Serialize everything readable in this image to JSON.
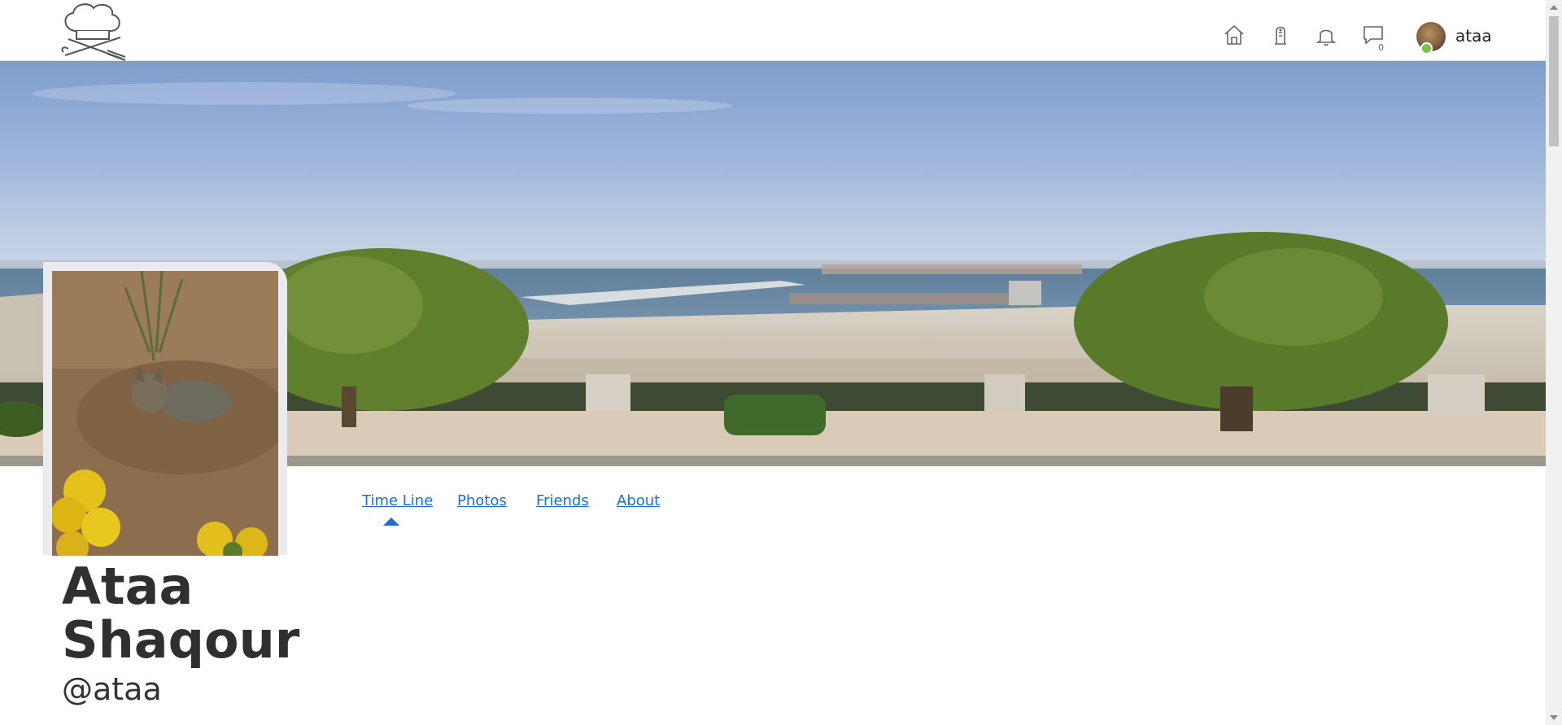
{
  "header": {
    "logo_icon": "chef-hat-logo-icon",
    "nav_icons": [
      "home-icon",
      "recipes-icon",
      "notifications-bell-icon",
      "messages-icon"
    ],
    "messages_badge": "0",
    "user_name": "ataa"
  },
  "profile": {
    "tabs": [
      {
        "label": "Time Line",
        "active": true
      },
      {
        "label": "Photos",
        "active": false
      },
      {
        "label": "Friends",
        "active": false
      },
      {
        "label": "About",
        "active": false
      }
    ],
    "first_name": "Ataa",
    "last_name": "Shaqour",
    "handle": "@ataa"
  },
  "colors": {
    "link": "#1a6fd0",
    "online": "#7ec242"
  }
}
